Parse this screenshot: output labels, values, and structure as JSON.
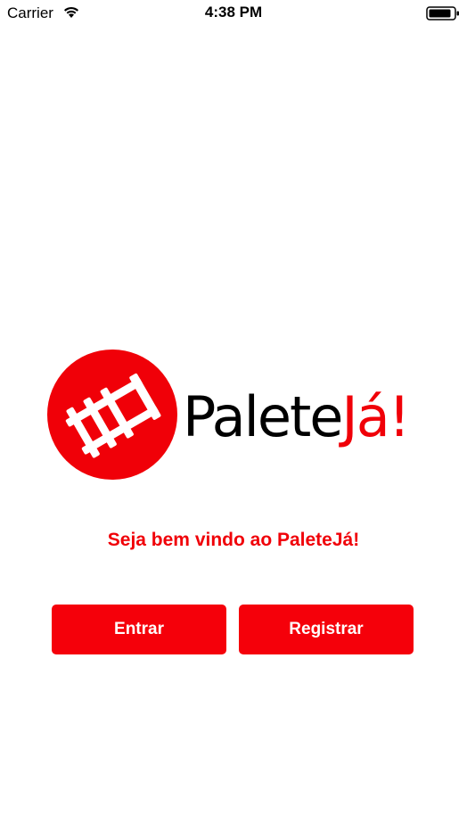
{
  "status_bar": {
    "carrier": "Carrier",
    "time": "4:38 PM",
    "wifi_icon": "wifi-icon",
    "battery_icon": "battery-icon"
  },
  "logo": {
    "brand_part1": "Palete",
    "brand_part2": "Já!",
    "brand_color": "#f00008",
    "icon": "pallet-icon"
  },
  "welcome_text": "Seja bem vindo ao PaleteJá!",
  "buttons": {
    "enter_label": "Entrar",
    "register_label": "Registrar"
  },
  "colors": {
    "accent": "#f5000a",
    "background": "#ffffff"
  }
}
